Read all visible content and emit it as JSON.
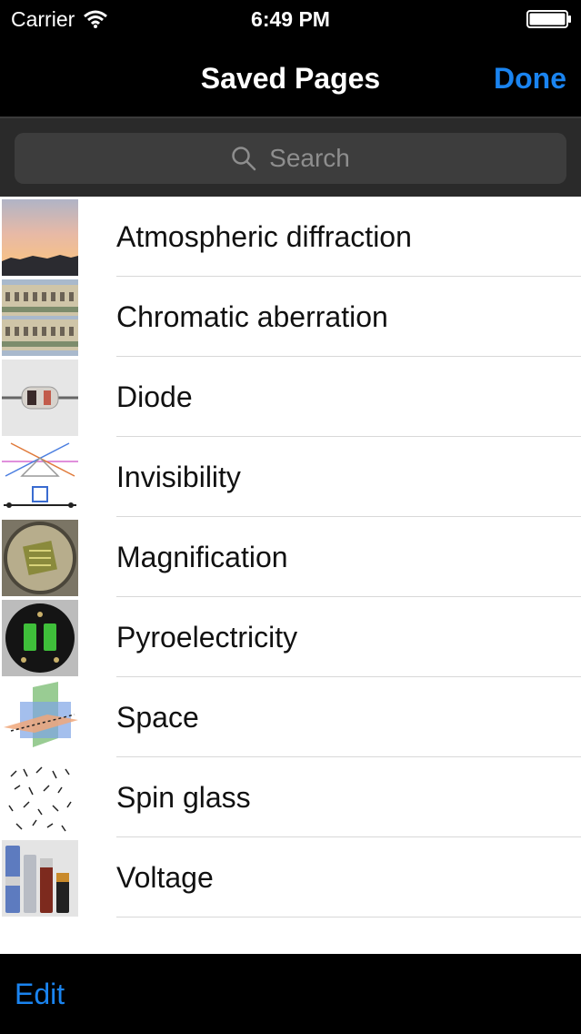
{
  "status_bar": {
    "carrier": "Carrier",
    "time": "6:49 PM"
  },
  "nav": {
    "title": "Saved Pages",
    "done_label": "Done"
  },
  "search": {
    "placeholder": "Search"
  },
  "saved_pages": [
    {
      "title": "Atmospheric diffraction",
      "thumbnail": "sunset-photo"
    },
    {
      "title": "Chromatic aberration",
      "thumbnail": "building-photo"
    },
    {
      "title": "Diode",
      "thumbnail": "diode-photo"
    },
    {
      "title": "Invisibility",
      "thumbnail": "ray-diagram"
    },
    {
      "title": "Magnification",
      "thumbnail": "magnifier-photo"
    },
    {
      "title": "Pyroelectricity",
      "thumbnail": "sensor-photo"
    },
    {
      "title": "Space",
      "thumbnail": "planes-diagram"
    },
    {
      "title": "Spin glass",
      "thumbnail": "spin-arrows-diagram"
    },
    {
      "title": "Voltage",
      "thumbnail": "batteries-photo"
    }
  ],
  "toolbar": {
    "edit_label": "Edit"
  },
  "colors": {
    "accent": "#1a84f0",
    "bar_background": "#000000",
    "search_bar_background": "#2a2a2a"
  }
}
